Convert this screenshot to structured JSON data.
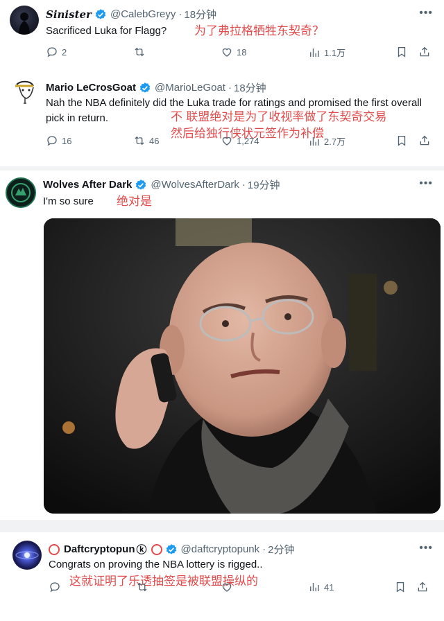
{
  "tweets": [
    {
      "name": "Sinister",
      "handle": "@CalebGreyy",
      "time": "18分钟",
      "text": "Sacrificed Luka for Flagg?",
      "annotation": "为了弗拉格牺牲东契奇？",
      "stats": {
        "replies": "2",
        "retweets": "",
        "likes": "18",
        "views": "1.1万"
      }
    },
    {
      "name": "Mario LeCrosGoat",
      "handle": "@MarioLeGoat",
      "time": "18分钟",
      "text": "Nah the NBA definitely did the Luka trade for ratings and promised the first overall pick in return.",
      "annotation_line1": "不 联盟绝对是为了收视率做了东契奇交易",
      "annotation_line2": "然后给独行侠状元签作为补偿",
      "stats": {
        "replies": "16",
        "retweets": "46",
        "likes": "1,274",
        "views": "2.7万"
      }
    },
    {
      "name": "Wolves After Dark",
      "handle": "@WolvesAfterDark",
      "time": "19分钟",
      "text": "I'm so sure",
      "annotation": "绝对是"
    },
    {
      "name": "Daftcryptopun",
      "name_suffix": "ⓚ",
      "handle": "@daftcryptopunk",
      "time": "2分钟",
      "text": "Congrats on proving the NBA lottery is rigged..",
      "annotation": "这就证明了乐透抽签是被联盟操纵的",
      "stats": {
        "replies": "",
        "retweets": "",
        "likes": "",
        "views": "41"
      }
    }
  ],
  "separator": "·",
  "more_glyph": "•••",
  "colors": {
    "verified": "#1d9bf0",
    "annotation": "#e24b4b",
    "muted": "#536471"
  }
}
